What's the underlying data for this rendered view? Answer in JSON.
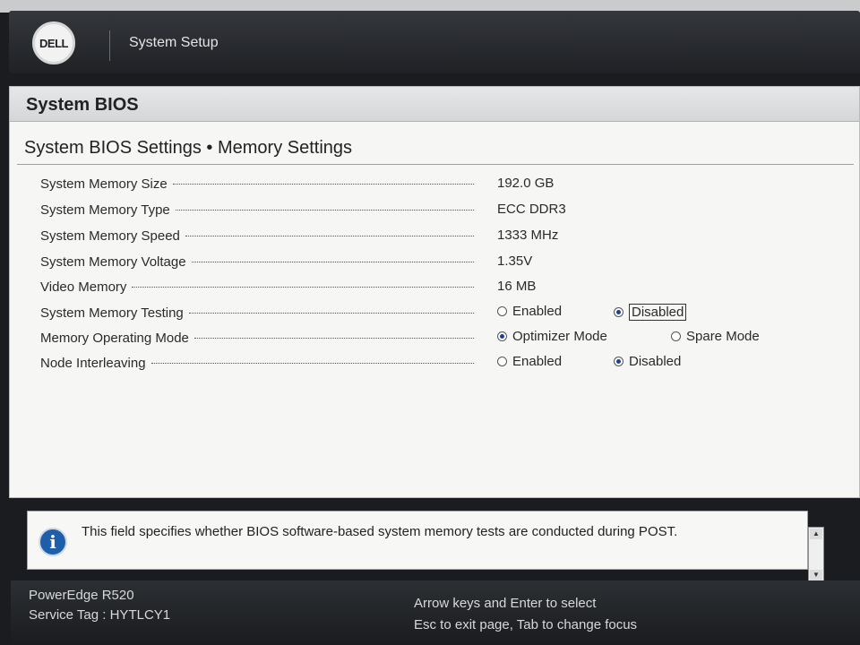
{
  "header": {
    "logo_text": "DELL",
    "app_title": "System Setup"
  },
  "panel": {
    "title": "System BIOS",
    "section_title": "System BIOS Settings • Memory Settings"
  },
  "settings": {
    "rows": [
      {
        "label": "System Memory Size",
        "value": "192.0 GB"
      },
      {
        "label": "System Memory Type",
        "value": "ECC DDR3"
      },
      {
        "label": "System Memory Speed",
        "value": "1333 MHz"
      },
      {
        "label": "System Memory Voltage",
        "value": "1.35V"
      },
      {
        "label": "Video Memory",
        "value": "16 MB"
      },
      {
        "label": "System Memory Testing",
        "options": [
          "Enabled",
          "Disabled"
        ],
        "selected": "Disabled"
      },
      {
        "label": "Memory Operating Mode",
        "options": [
          "Optimizer Mode",
          "Spare Mode"
        ],
        "selected": "Optimizer Mode"
      },
      {
        "label": "Node Interleaving",
        "options": [
          "Enabled",
          "Disabled"
        ],
        "selected": "Disabled"
      }
    ]
  },
  "help": {
    "icon": "info-icon",
    "text": "This field specifies whether BIOS software-based system memory tests are conducted during POST."
  },
  "status": {
    "model": "PowerEdge R520",
    "service_tag": "Service Tag : HYTLCY1",
    "hint_1": "Arrow keys and Enter to select",
    "hint_2": "Esc to exit page, Tab to change focus"
  },
  "colors": {
    "header_bg": "#1f2125",
    "panel_bg": "#f6f6f5",
    "radio_selected": "#1e3f93",
    "info_icon": "#1f5ea8"
  }
}
